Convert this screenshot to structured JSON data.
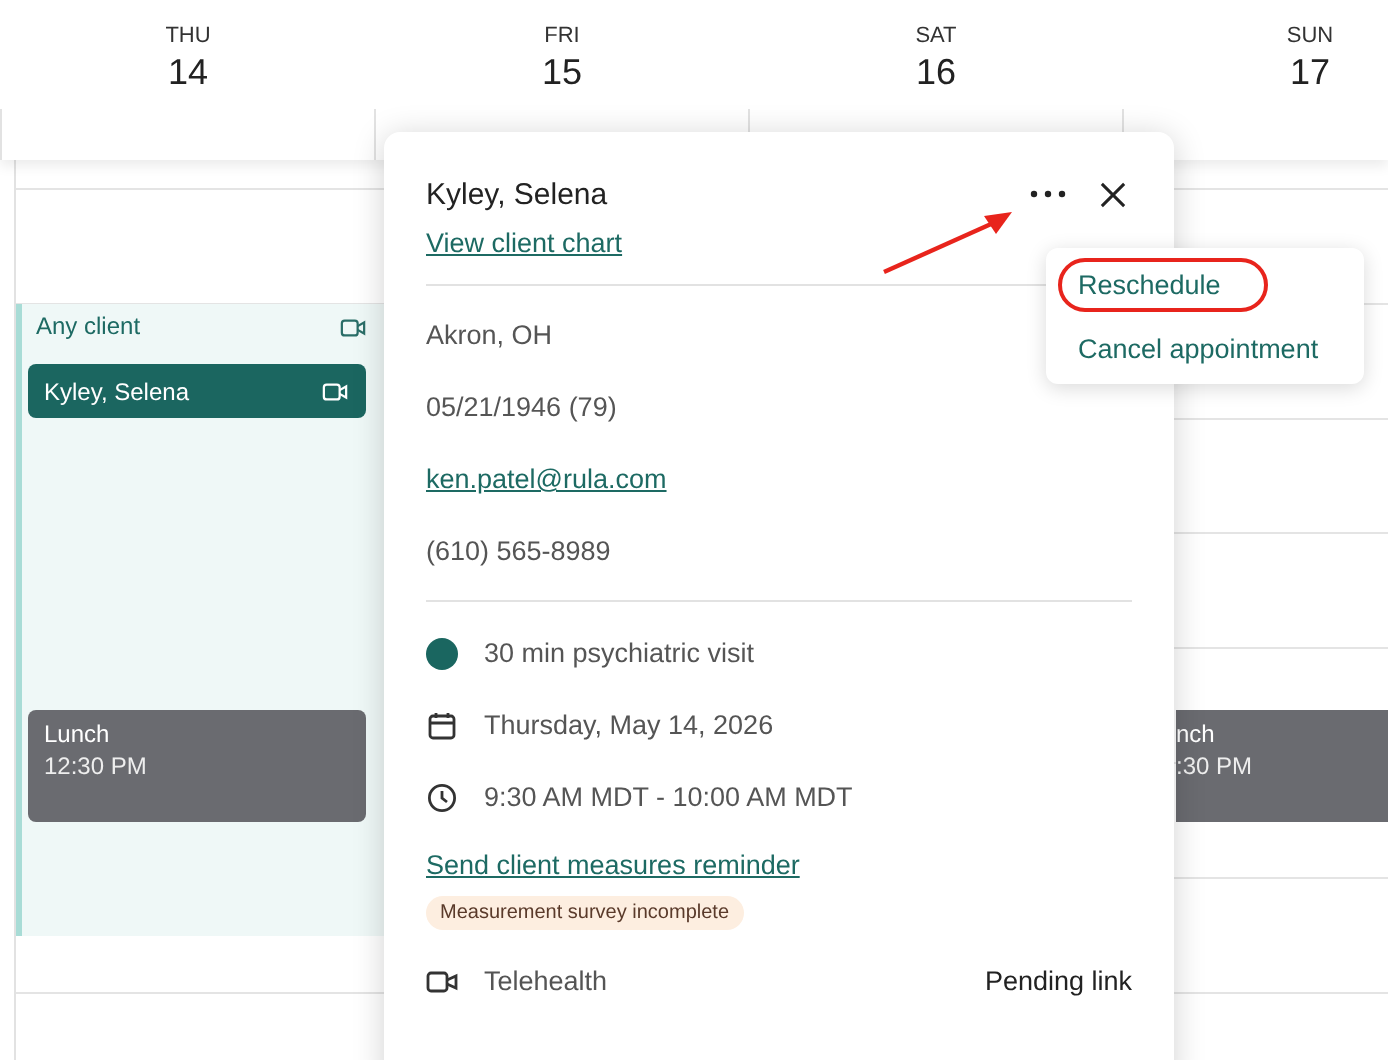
{
  "days": [
    {
      "weekday": "THU",
      "date": "14"
    },
    {
      "weekday": "FRI",
      "date": "15"
    },
    {
      "weekday": "SAT",
      "date": "16"
    },
    {
      "weekday": "SUN",
      "date": "17"
    }
  ],
  "events": [
    {
      "kind": "availability",
      "title": "Any client",
      "video": true
    },
    {
      "kind": "appointment",
      "title": "Kyley, Selena",
      "video": true
    },
    {
      "kind": "lunch",
      "title": "Lunch",
      "time": "12:30 PM"
    },
    {
      "kind": "lunch_cut",
      "title": "nch",
      "time": ":30 PM"
    }
  ],
  "popup": {
    "title": "Kyley, Selena",
    "chart_link": "View client chart",
    "client": [
      {
        "kind": "text",
        "value": "Akron, OH"
      },
      {
        "kind": "text",
        "value": "05/21/1946 (79)"
      },
      {
        "kind": "link",
        "value": "ken.patel@rula.com"
      },
      {
        "kind": "text",
        "value": "(610) 565-8989"
      }
    ],
    "appointment": [
      {
        "kind": "dot",
        "value": "30 min psychiatric visit",
        "color": "#1a6660"
      },
      {
        "kind": "calendar",
        "value": "Thursday, May 14, 2026"
      },
      {
        "kind": "clock",
        "value": "9:30 AM MDT - 10:00 AM MDT"
      }
    ],
    "reminder_link": "Send client measures reminder",
    "badge": "Measurement survey incomplete",
    "telehealth": {
      "label": "Telehealth",
      "status": "Pending link"
    }
  },
  "menu": [
    {
      "label": "Reschedule",
      "highlighted": true
    },
    {
      "label": "Cancel appointment",
      "highlighted": false
    }
  ]
}
